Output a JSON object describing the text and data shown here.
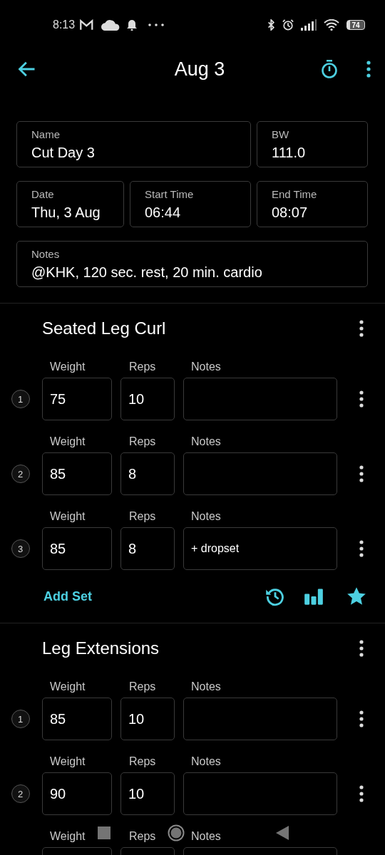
{
  "status_bar": {
    "time": "8:13",
    "battery": "74"
  },
  "header": {
    "title": "Aug 3"
  },
  "fields": [
    {
      "label": "Name",
      "value": "Cut Day 3"
    },
    {
      "label": "BW",
      "value": "111.0"
    },
    {
      "label": "Date",
      "value": "Thu, 3 Aug"
    },
    {
      "label": "Start Time",
      "value": "06:44"
    },
    {
      "label": "End Time",
      "value": "08:07"
    },
    {
      "label": "Notes",
      "value": "@KHK, 120 sec. rest, 20 min. cardio"
    }
  ],
  "exercises": [
    {
      "name": "Seated Leg Curl",
      "add_set": "Add Set",
      "sets": [
        {
          "number": "1",
          "weight_label": "Weight",
          "weight": "75",
          "reps_label": "Reps",
          "reps": "10",
          "notes_label": "Notes"
        },
        {
          "number": "2",
          "weight_label": "Weight",
          "weight": "85",
          "reps_label": "Reps",
          "reps": "8",
          "notes_label": "Notes"
        },
        {
          "number": "3",
          "weight_label": "Weight",
          "weight": "85",
          "reps_label": "Reps",
          "reps": "8",
          "notes_label": "Notes",
          "notes": "+ dropset"
        }
      ]
    },
    {
      "name": "Leg Extensions",
      "sets": [
        {
          "number": "1",
          "weight_label": "Weight",
          "weight": "85",
          "reps_label": "Reps",
          "reps": "10",
          "notes_label": "Notes"
        },
        {
          "number": "2",
          "weight_label": "Weight",
          "weight": "90",
          "reps_label": "Reps",
          "reps": "10",
          "notes_label": "Notes"
        },
        {
          "weight_label": "Weight",
          "reps_label": "Reps",
          "notes_label": "Notes"
        }
      ]
    }
  ]
}
